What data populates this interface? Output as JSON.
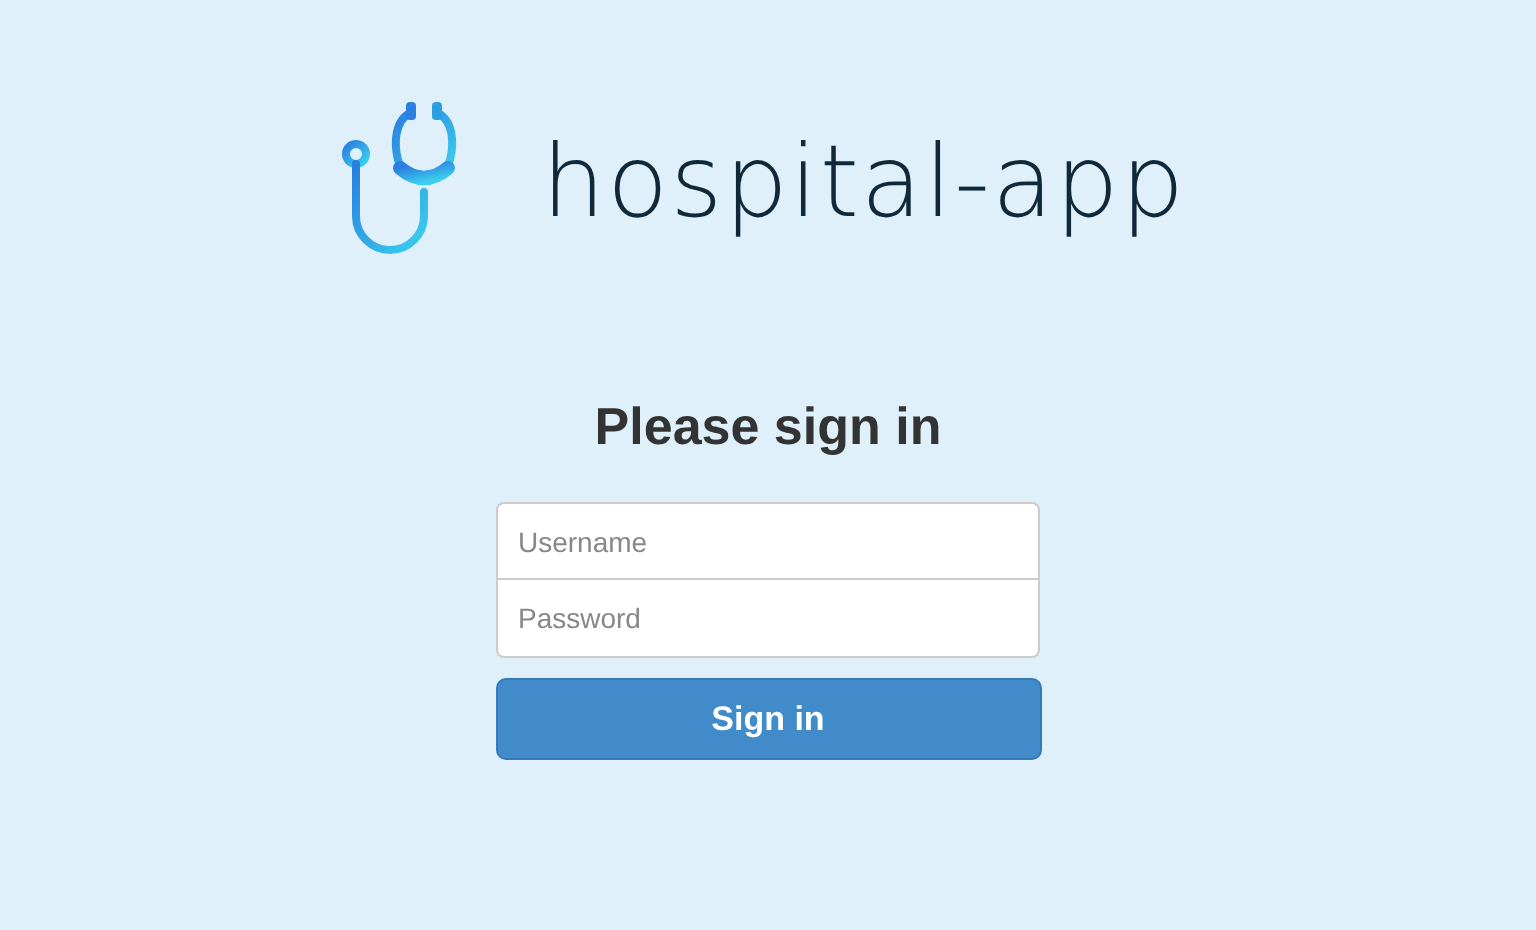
{
  "logo": {
    "text": "hospital-app"
  },
  "form": {
    "heading": "Please sign in",
    "fields": [
      {
        "placeholder": "Username"
      },
      {
        "placeholder": "Password"
      }
    ],
    "button": "Sign in"
  }
}
